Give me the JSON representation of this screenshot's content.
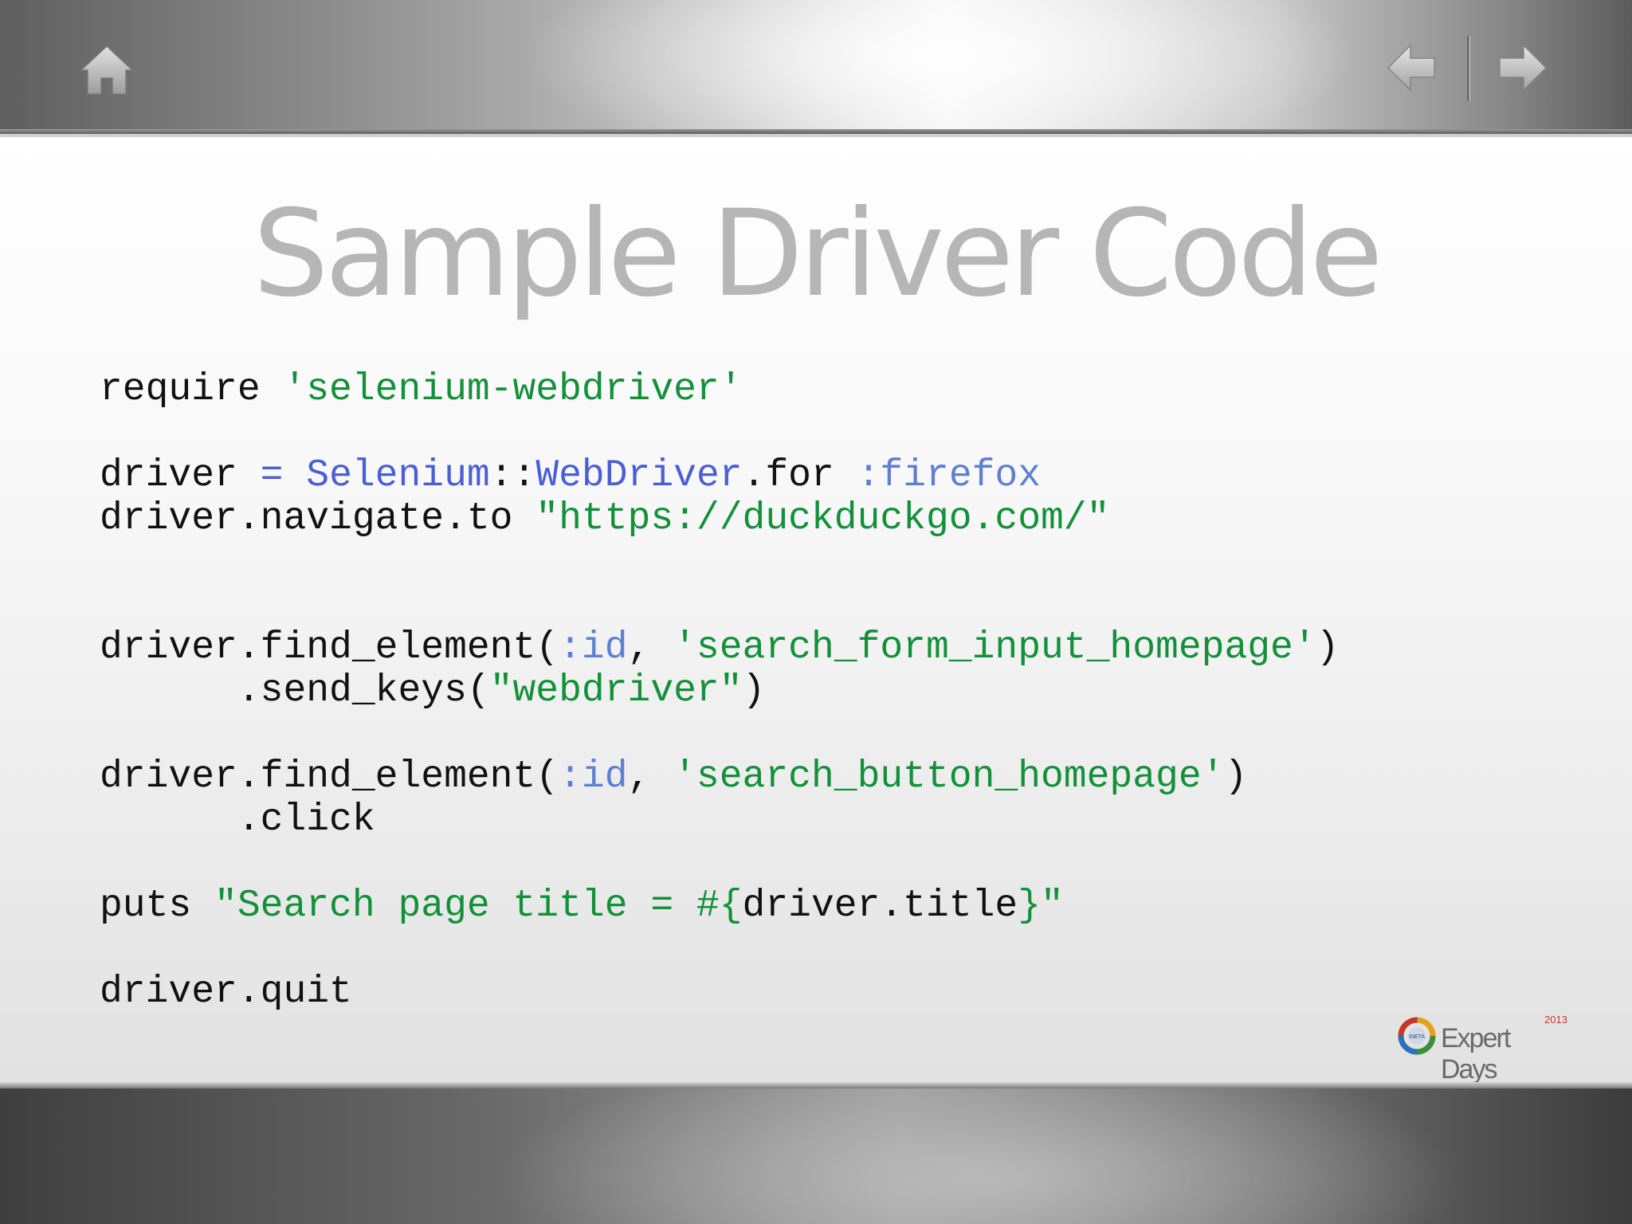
{
  "toolbar": {
    "home_icon": "home-icon",
    "prev_icon": "arrow-left-icon",
    "next_icon": "arrow-right-icon"
  },
  "slide": {
    "title": "Sample Driver Code",
    "code_lines": [
      [
        {
          "t": "require "
        },
        {
          "t": "'selenium-webdriver'",
          "c": "str"
        }
      ],
      [],
      [
        {
          "t": "driver "
        },
        {
          "t": "=",
          "c": "const"
        },
        {
          "t": " "
        },
        {
          "t": "Selenium",
          "c": "const"
        },
        {
          "t": "::"
        },
        {
          "t": "WebDriver",
          "c": "const"
        },
        {
          "t": ".for "
        },
        {
          "t": ":firefox",
          "c": "sym"
        }
      ],
      [
        {
          "t": "driver.navigate.to "
        },
        {
          "t": "\"https://duckduckgo.com/\"",
          "c": "str"
        }
      ],
      [],
      [],
      [
        {
          "t": "driver.find_element("
        },
        {
          "t": ":id",
          "c": "sym"
        },
        {
          "t": ", "
        },
        {
          "t": "'search_form_input_homepage'",
          "c": "str"
        },
        {
          "t": ")"
        }
      ],
      [
        {
          "t": "      .send_keys("
        },
        {
          "t": "\"webdriver\"",
          "c": "str"
        },
        {
          "t": ")"
        }
      ],
      [],
      [
        {
          "t": "driver.find_element("
        },
        {
          "t": ":id",
          "c": "sym"
        },
        {
          "t": ", "
        },
        {
          "t": "'search_button_homepage'",
          "c": "str"
        },
        {
          "t": ")"
        }
      ],
      [
        {
          "t": "      .click"
        }
      ],
      [],
      [
        {
          "t": "puts "
        },
        {
          "t": "\"Search page title = #{",
          "c": "str"
        },
        {
          "t": "driver.title"
        },
        {
          "t": "}\"",
          "c": "str"
        }
      ],
      [],
      [
        {
          "t": "driver.quit"
        }
      ]
    ]
  },
  "logo": {
    "text": "Expert Days",
    "year": "2013",
    "badge": "INETA"
  },
  "colors": {
    "title": "#b6b6b6",
    "string": "#12903a",
    "symbol": "#5f7fd0",
    "constant": "#4a5fd6",
    "code": "#111111"
  }
}
